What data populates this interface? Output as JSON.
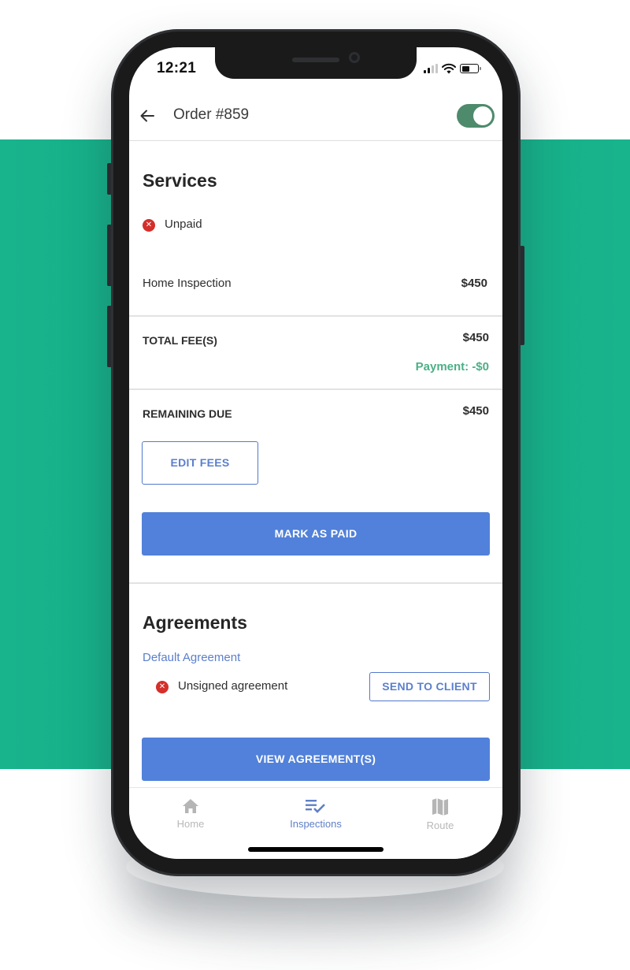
{
  "status_bar": {
    "time": "12:21",
    "icons": [
      "cellular-signal-icon",
      "wifi-icon",
      "battery-icon"
    ]
  },
  "header": {
    "back_icon": "arrow-left-icon",
    "title": "Order #859",
    "toggle_on": true
  },
  "services": {
    "heading": "Services",
    "payment_status": "Unpaid",
    "status_icon": "error-x-icon",
    "line_items": [
      {
        "name": "Home Inspection",
        "price": "$450"
      }
    ],
    "total_label": "TOTAL FEE(S)",
    "total_value": "$450",
    "payment_line": "Payment: -$0",
    "remaining_label": "REMAINING DUE",
    "remaining_value": "$450",
    "edit_fees_label": "EDIT FEES",
    "mark_paid_label": "MARK AS PAID"
  },
  "agreements": {
    "heading": "Agreements",
    "agreement_name": "Default Agreement",
    "agreement_status": "Unsigned agreement",
    "send_to_client_label": "SEND TO CLIENT",
    "view_agreements_label": "VIEW AGREEMENT(S)"
  },
  "tab_bar": {
    "tabs": [
      {
        "label": "Home",
        "icon": "home-icon",
        "active": false
      },
      {
        "label": "Inspections",
        "icon": "checklist-icon",
        "active": true
      },
      {
        "label": "Route",
        "icon": "map-icon",
        "active": false
      }
    ]
  },
  "colors": {
    "background_band": "#18b48c",
    "primary_blue": "#5181da",
    "link_blue": "#5b7fcc",
    "toggle_green": "#4e8a6c",
    "payment_green": "#4caf87",
    "error_red": "#d42f2a"
  }
}
